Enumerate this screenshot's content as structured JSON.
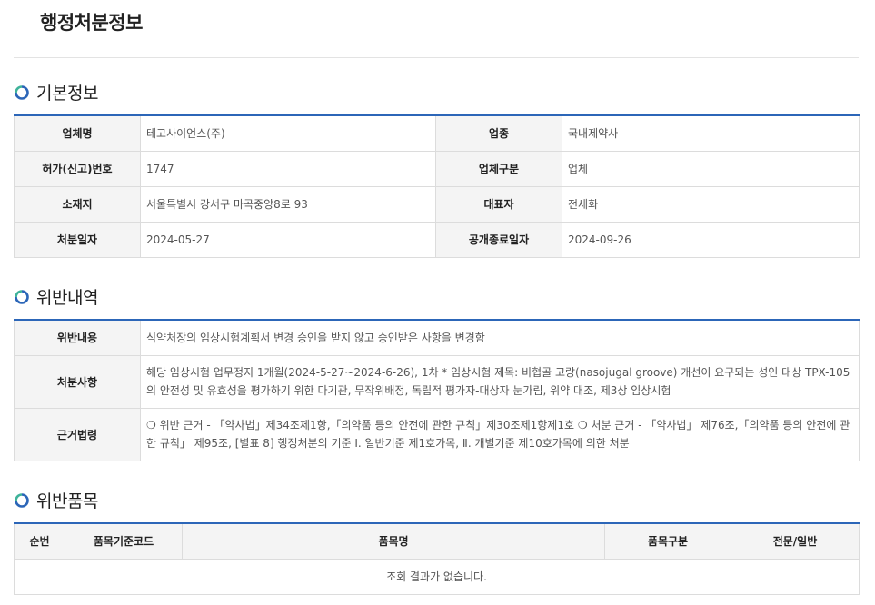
{
  "page_title": "행정처분정보",
  "basic": {
    "heading": "기본정보",
    "rows": [
      {
        "l1": "업체명",
        "v1": "테고사이언스(주)",
        "l2": "업종",
        "v2": "국내제약사"
      },
      {
        "l1": "허가(신고)번호",
        "v1": "1747",
        "l2": "업체구분",
        "v2": "업체"
      },
      {
        "l1": "소재지",
        "v1": "서울특별시 강서구 마곡중앙8로 93",
        "l2": "대표자",
        "v2": "전세화"
      },
      {
        "l1": "처분일자",
        "v1": "2024-05-27",
        "l2": "공개종료일자",
        "v2": "2024-09-26"
      }
    ]
  },
  "violation": {
    "heading": "위반내역",
    "rows": [
      {
        "label": "위반내용",
        "value": "식약처장의 임상시험계획서 변경 승인을 받지 않고 승인받은 사항을 변경함"
      },
      {
        "label": "처분사항",
        "value": "해당 임상시험 업무정지 1개월(2024-5-27~2024-6-26), 1차 * 임상시험 제목: 비협골 고랑(nasojugal groove) 개선이 요구되는 성인 대상 TPX-105의 안전성 및 유효성을 평가하기 위한 다기관, 무작위배정, 독립적 평가자-대상자 눈가림, 위약 대조, 제3상 임상시험"
      },
      {
        "label": "근거법령",
        "value": "❍ 위반 근거 - 「약사법」제34조제1항,「의약품 등의 안전에 관한 규칙」제30조제1항제1호 ❍ 처분 근거 - 「약사법」 제76조,「의약품 등의 안전에 관한 규칙」 제95조, [별표 8] 행정처분의 기준 Ⅰ. 일반기준 제1호가목, Ⅱ. 개별기준 제10호가목에 의한 처분"
      }
    ]
  },
  "items": {
    "heading": "위반품목",
    "columns": [
      "순번",
      "품목기준코드",
      "품목명",
      "품목구분",
      "전문/일반"
    ],
    "empty_message": "조회 결과가 없습니다."
  },
  "colors": {
    "accent": "#2c66b8",
    "icon_green": "#3fb39a",
    "icon_blue": "#2c66b8"
  },
  "icons": {
    "section_icon": "refresh-ring-icon"
  }
}
